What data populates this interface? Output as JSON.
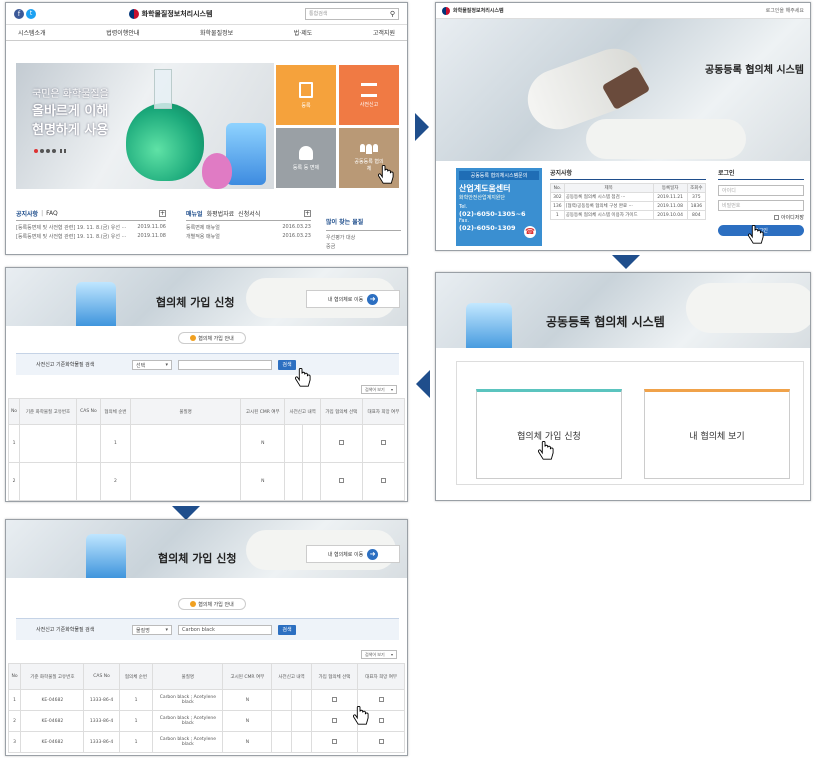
{
  "p1": {
    "title": "화학물질정보처리시스템",
    "search_placeholder": "통합검색",
    "nav": [
      "시스템소개",
      "법령이행안내",
      "화학물질정보",
      "법·제도",
      "고객지원"
    ],
    "hero": [
      "국민은 화학물질을",
      "올바르게 이해",
      "현명하게 사용"
    ],
    "tiles": [
      "등록",
      "사전신고",
      "등록 등 면제",
      "공동등록 협의체"
    ],
    "notice_tabs": [
      "공지사항",
      "FAQ"
    ],
    "notice_items": [
      {
        "t": "[등록등면제 및 사전협 관련] 19. 11. 8.(금) 유선 ···",
        "d": "2019.11.06"
      },
      {
        "t": "[등록등면제 및 사전협 관련] 19. 11. 8.(금) 유선 ···",
        "d": "2019.11.08"
      }
    ],
    "manual_tabs": [
      "매뉴얼",
      "화평법자료",
      "신청서식"
    ],
    "manual_items": [
      {
        "t": "등록면제 매뉴얼",
        "d": "2016.03.23"
      },
      {
        "t": "개별적용 매뉴얼",
        "d": "2016.03.23"
      }
    ],
    "faq_title": "많이 찾는 물질",
    "faq_items": [
      "우선평가 대상",
      "중금"
    ]
  },
  "p2": {
    "title": "화학물질정보처리시스템",
    "top_link": "로그인을 해주세요",
    "banner": "공동등록 협의체 시스템",
    "contact_head": "공동등록 협의체시스템문의",
    "contact_name": "산업계도움센터",
    "contact_sub": "화학안전산업계지원단",
    "tel_label": "Tel.",
    "tel": "(02)-6050-1305~6",
    "fax_label": "Fax.",
    "fax": "(02)-6050-1309",
    "notice_title": "공지사항",
    "notice_cols": [
      "No.",
      "제목",
      "등록일자",
      "조회수"
    ],
    "notice_rows": [
      [
        "302",
        "공동등록 협의체 시스템 점검 ···",
        "2019.11.21",
        "375"
      ],
      [
        "136",
        "[협력/공동등록 협의체 구성 완료 ···",
        "2019.11.08",
        "1836"
      ],
      [
        "1",
        "공동등록 협의체 시스템 이용자 가이드",
        "2019.10.04",
        "804"
      ]
    ],
    "login_title": "로그인",
    "id_placeholder": "아이디",
    "pw_placeholder": "비밀번호",
    "remember": "아이디저장",
    "login_btn": "로그인"
  },
  "p3": {
    "banner": "협의체 가입 신청",
    "my_btn": "내 협의체로 이동",
    "guide": "협의체 가입 안내",
    "search_label": "사전신고 기준화학물질 검색",
    "select": "선택",
    "search_btn": "검색",
    "sort": "검색어 보기",
    "cols": [
      "No",
      "기준 화학물질 고유번호",
      "CAS No",
      "협의체 순번",
      "물질명",
      "고시된 CMR 여부",
      "사전신고 내역",
      "접수번호 (신청번호)",
      "제조·수입량 범위 (등록형태)",
      "가입 협의체 선택",
      "대표자 희망 여부"
    ],
    "rows": [
      [
        "1",
        "",
        "",
        "1",
        "",
        "N",
        "",
        "",
        ""
      ],
      [
        "2",
        "",
        "",
        "2",
        "",
        "N",
        "",
        "",
        ""
      ]
    ]
  },
  "p4": {
    "banner": "공동등록 협의체 시스템",
    "card1": "협의체 가입 신청",
    "card2": "내 협의체 보기"
  },
  "p5": {
    "banner": "협의체 가입 신청",
    "my_btn": "내 협의체로 이동",
    "guide": "협의체 가입 안내",
    "search_label": "사전신고 기준화학물질 검색",
    "select": "물질명",
    "value": "Carbon black",
    "search_btn": "검색",
    "sort": "검색어 보기",
    "cols": [
      "No",
      "기준 화학물질 고유번호",
      "CAS No",
      "협의체 순번",
      "물질명",
      "고시된 CMR 여부",
      "사전신고 내역",
      "접수번호 (신청번호)",
      "제조·수입량 범위 (등록형태)",
      "가입 협의체 선택",
      "대표자 희망 여부"
    ],
    "rows": [
      [
        "1",
        "KE-04682",
        "1333-86-4",
        "1",
        "Carbon black ; Acetylene black",
        "N"
      ],
      [
        "2",
        "KE-04682",
        "1333-86-4",
        "1",
        "Carbon black ; Acetylene black",
        "N"
      ],
      [
        "3",
        "KE-04682",
        "1333-86-4",
        "1",
        "Carbon black ; Acetylene black",
        "N"
      ]
    ]
  },
  "colors": {
    "arrow": "#1f4e8c",
    "orange": "#f08a3a",
    "tan": "#b99976",
    "blue_btn": "#2c6fc1",
    "contact_bg": "#3a8fd1"
  }
}
